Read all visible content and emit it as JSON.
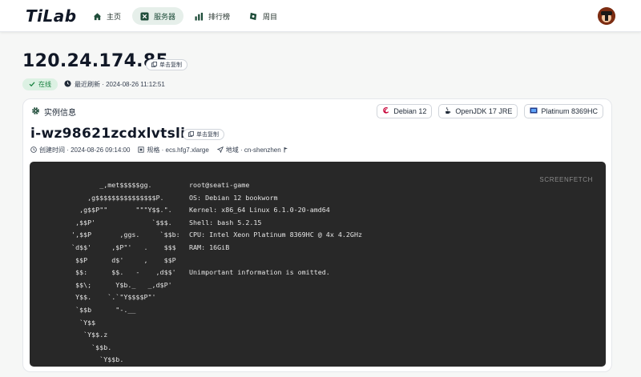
{
  "app": {
    "logo": "TiLab"
  },
  "nav": [
    {
      "label": "主页",
      "icon": "home-icon",
      "active": false
    },
    {
      "label": "服务器",
      "icon": "server-icon",
      "active": true
    },
    {
      "label": "排行榜",
      "icon": "leaderboard-icon",
      "active": false
    },
    {
      "label": "周目",
      "icon": "cycle-icon",
      "active": false
    }
  ],
  "server": {
    "ip": "120.24.174.85",
    "copy_label": "单击复制",
    "status": "在线",
    "last_refresh_label": "最近刷新 · 2024-08-26 11:12:51"
  },
  "instance": {
    "section_title": "实例信息",
    "tags": [
      "Debian 12",
      "OpenJDK 17 JRE",
      "Platinum 8369HC"
    ],
    "id": "i-wz98621zcdxlvtsliscr",
    "copy_label": "单击复制",
    "meta": {
      "created": "创建时间 · 2024-08-26 09:14:00",
      "spec": "规格 · ecs.hfg7.xlarge",
      "region": "地域 · cn-shenzhen"
    }
  },
  "terminal": {
    "label": "SCREENFETCH",
    "ascii": "         _,met$$$$$gg.\n      ,g$$$$$$$$$$$$$$$P.\n    ,g$$P\"\"       \"\"\"Y$$.\".\n   ,$$P'              `$$$.\n  ',$$P       ,ggs.     `$$b:\n  `d$$'     ,$P\"'   .    $$$\n   $$P      d$'     ,    $$P\n   $$:      $$.   -    ,d$$'\n   $$\\;      Y$b._   _,d$P'\n   Y$$.    `.`\"Y$$$$P\"'\n   `$$b      \"-.__\n    `Y$$\n     `Y$$.z\n       `$$b.\n         `Y$$b.\n            `\"Y$b._\n                `\"\"\"\"`",
    "info": "root@seati-game\nOS: Debian 12 bookworm\nKernel: x86_64 Linux 6.1.0-20-amd64\nShell: bash 5.2.15\nCPU: Intel Xeon Platinum 8369HC @ 4x 4.2GHz\nRAM: 16GiB\n\nUnimportant information is omitted."
  },
  "colors": {
    "accent": "#1f4d3a",
    "online": "#15803d",
    "terminal_bg": "#282828"
  }
}
